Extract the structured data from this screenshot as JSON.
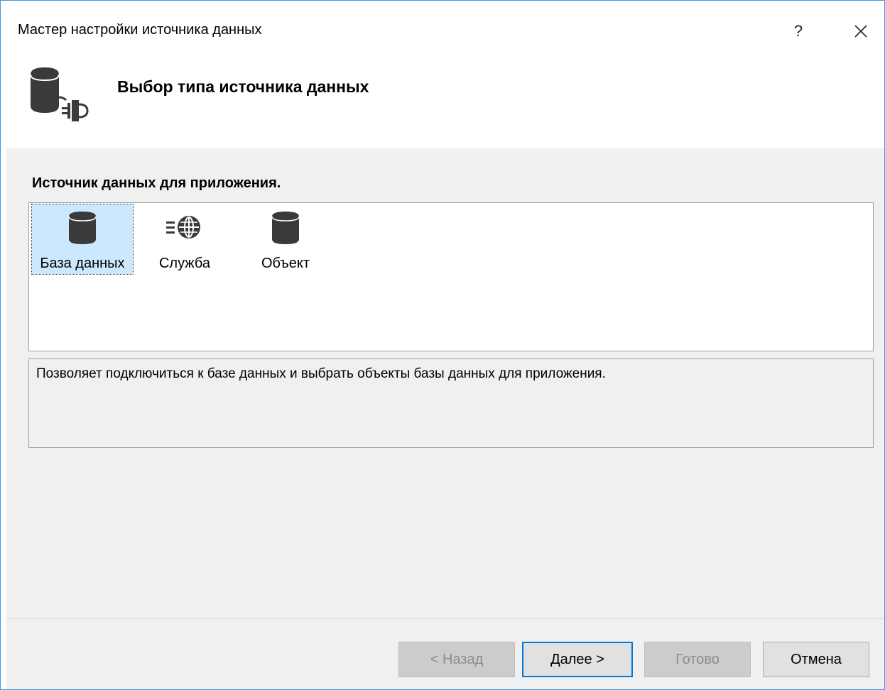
{
  "window": {
    "title": "Мастер настройки источника данных",
    "help_label": "?"
  },
  "header": {
    "title": "Выбор типа источника данных",
    "icon": "database-plug-icon"
  },
  "main": {
    "section_label": "Источник данных для приложения.",
    "items": [
      {
        "label": "База данных",
        "icon": "database-icon",
        "selected": true
      },
      {
        "label": "Служба",
        "icon": "globe-service-icon",
        "selected": false
      },
      {
        "label": "Объект",
        "icon": "object-icon",
        "selected": false
      }
    ],
    "description": "Позволяет подключиться к базе данных и выбрать объекты базы данных для приложения."
  },
  "footer": {
    "back_label": "< Назад",
    "next_label": "Далее >",
    "finish_label": "Готово",
    "cancel_label": "Отмена"
  },
  "colors": {
    "accent": "#0078d7",
    "selection": "#cce8ff",
    "panel": "#f0f0f0",
    "icon": "#3a3a3a"
  }
}
